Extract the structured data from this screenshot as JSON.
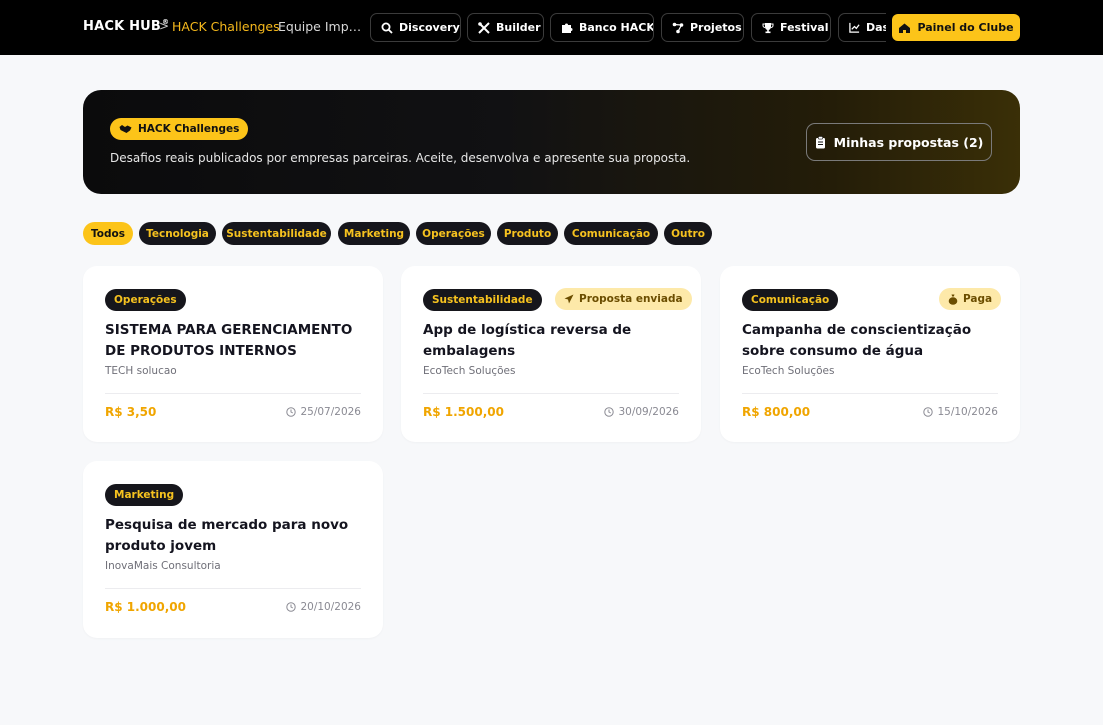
{
  "header": {
    "brand": "HACK HUB",
    "brand_mark": "®",
    "crumb_separator": ">",
    "crumb_active": "HACK Challenges",
    "crumb_team": "Equipe Impacto Jovem",
    "nav": [
      {
        "label": "Discovery",
        "icon": "search-icon"
      },
      {
        "label": "Builder",
        "icon": "tools-icon"
      },
      {
        "label": "Banco HACK",
        "icon": "puzzle-icon"
      },
      {
        "label": "Projetos",
        "icon": "nodes-icon"
      },
      {
        "label": "Festival",
        "icon": "trophy-icon"
      },
      {
        "label": "Dashboard",
        "icon": "chart-icon"
      }
    ],
    "club_button": "Painel do Clube"
  },
  "hero": {
    "pill": "HACK Challenges",
    "description": "Desafios reais publicados por empresas parceiras. Aceite, desenvolva e apresente sua proposta.",
    "proposals_button": "Minhas propostas (2)"
  },
  "filters": [
    "Todos",
    "Tecnologia",
    "Sustentabilidade",
    "Marketing",
    "Operações",
    "Produto",
    "Comunicação",
    "Outro"
  ],
  "active_filter": "Todos",
  "challenges": [
    {
      "category": "Operações",
      "status": "",
      "title": "SISTEMA PARA GERENCIAMENTO DE PRODUTOS INTERNOS",
      "company": "TECH solucao",
      "price": "R$ 3,50",
      "date": "25/07/2026"
    },
    {
      "category": "Sustentabilidade",
      "status": "Proposta enviada",
      "title": "App de logística reversa de embalagens",
      "company": "EcoTech Soluções",
      "price": "R$ 1.500,00",
      "date": "30/09/2026"
    },
    {
      "category": "Comunicação",
      "status": "Paga",
      "title": "Campanha de conscientização sobre consumo de água",
      "company": "EcoTech Soluções",
      "price": "R$ 800,00",
      "date": "15/10/2026"
    },
    {
      "category": "Marketing",
      "status": "",
      "title": "Pesquisa de mercado para novo produto jovem",
      "company": "InovaMais Consultoria",
      "price": "R$ 1.000,00",
      "date": "20/10/2026"
    }
  ],
  "colors": {
    "accent": "#fcc419",
    "price": "#f0a500",
    "dark": "#16161c",
    "page_bg": "#f7f8fa"
  }
}
